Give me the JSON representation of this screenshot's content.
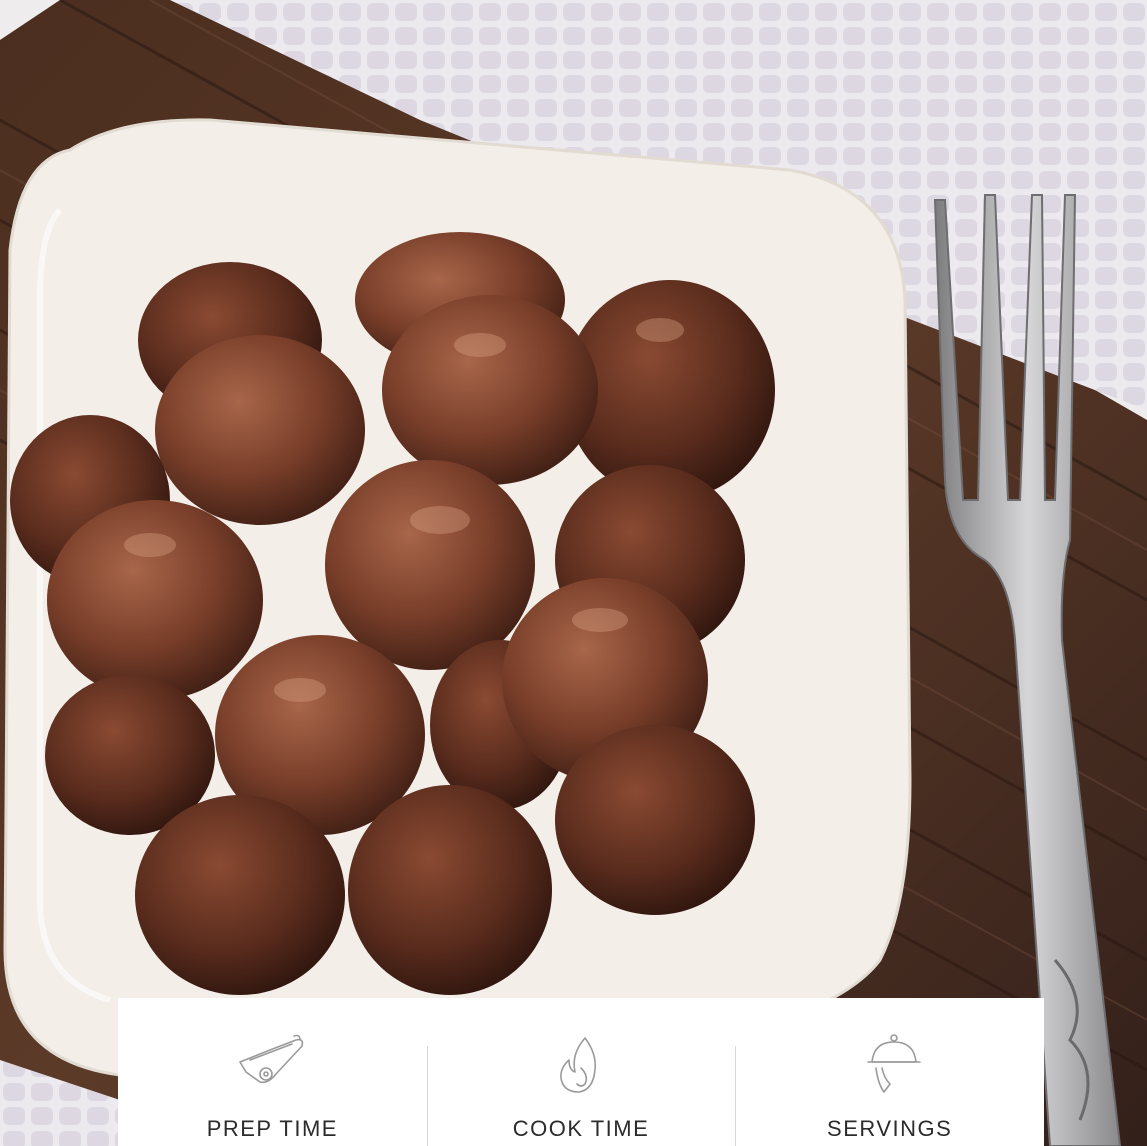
{
  "photo": {
    "subject": "meatballs in white square bowl with fork on wooden board",
    "colors": {
      "board_dark": "#3a2418",
      "board_light": "#6a4a35",
      "towel": "#e9e6ec",
      "bowl": "#f4efe9",
      "meatball": "#7a4330",
      "fork": "#a9a9ab"
    }
  },
  "recipe_info": {
    "items": [
      {
        "icon": "cutting-board-icon",
        "label": "PREP TIME"
      },
      {
        "icon": "flame-icon",
        "label": "COOK TIME"
      },
      {
        "icon": "serving-cloche-icon",
        "label": "SERVINGS"
      }
    ]
  }
}
